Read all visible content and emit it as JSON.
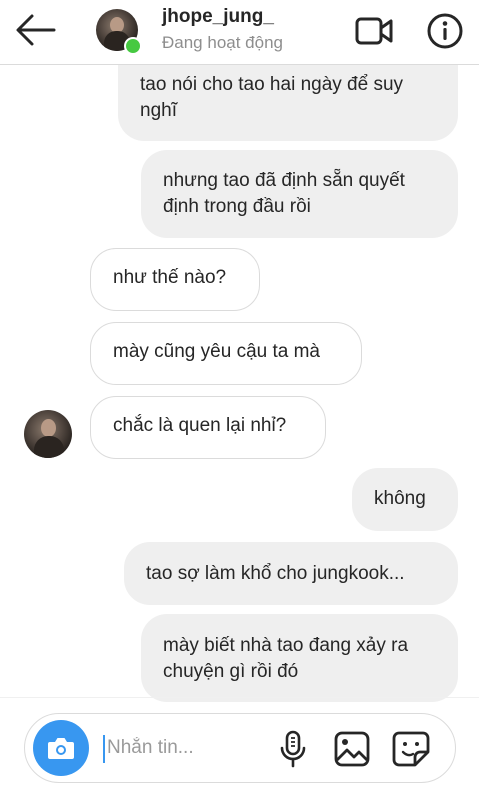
{
  "header": {
    "username": "jhope_jung_",
    "status": "Đang hoạt động",
    "online_color": "#46c941",
    "icons": [
      "back-arrow-icon",
      "video-call-icon",
      "info-icon"
    ]
  },
  "messages": [
    {
      "side": "right",
      "text": "tao nói cho tao hai ngày để suy nghĩ"
    },
    {
      "side": "right",
      "text": "nhưng tao đã định sẵn quyết định trong đầu rồi"
    },
    {
      "side": "left",
      "text": "như thế nào?"
    },
    {
      "side": "left",
      "text": "mày cũng yêu cậu ta mà"
    },
    {
      "side": "left",
      "text": "chắc là quen lại nhỉ?"
    },
    {
      "side": "right",
      "text": "không"
    },
    {
      "side": "right",
      "text": "tao sợ làm khổ cho jungkook..."
    },
    {
      "side": "right",
      "text": "mày biết nhà tao đang xảy ra chuyện gì rồi đó"
    }
  ],
  "composer": {
    "placeholder": "Nhắn tin...",
    "accent": "#3897f0",
    "icons": [
      "camera-icon",
      "microphone-icon",
      "gallery-icon",
      "sticker-icon"
    ]
  }
}
